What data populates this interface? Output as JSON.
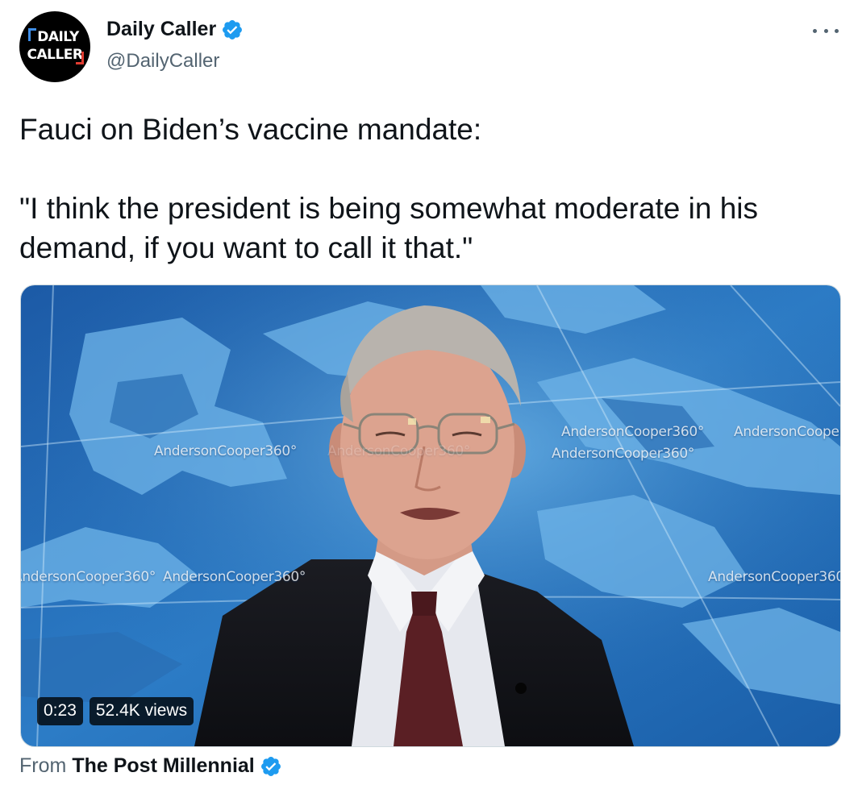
{
  "author": {
    "display_name": "Daily Caller",
    "handle": "@DailyCaller",
    "avatar_logo": [
      "DAILY",
      "CALLER"
    ],
    "verified_icon": "verified-badge-icon"
  },
  "more_icon": "more-options-icon",
  "tweet": {
    "text": "Fauci on Biden’s vaccine mandate:\n\n\"I think the president is being somewhat moderate in his demand, if you want to call it that.\""
  },
  "media": {
    "overlay_labels": [
      "AndersonCooper360°",
      "AndersonCooper360°",
      "AndersonCooper360°",
      "AndersonCooper360°",
      "AndersonCooper360°",
      "AndersonCooper360°",
      "AndersonCooper360°",
      "AndersonCooper360°"
    ],
    "duration": "0:23",
    "views": "52.4K views"
  },
  "attribution": {
    "label": "From",
    "source": "The Post Millennial"
  },
  "colors": {
    "verified": "#1d9bf0",
    "text_primary": "#0f1419",
    "text_secondary": "#536471",
    "map_blue": "#2a78c0"
  }
}
